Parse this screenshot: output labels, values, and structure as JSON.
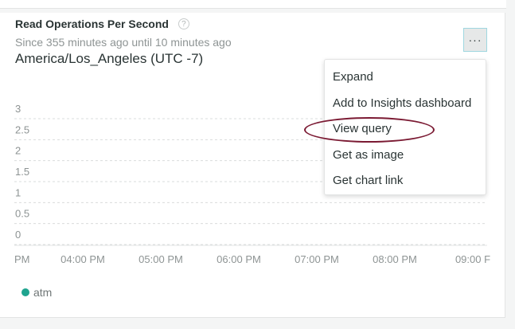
{
  "card": {
    "title": "Read Operations Per Second",
    "subtitle": "Since 355 minutes ago until 10 minutes ago",
    "timezone": "America/Los_Angeles (UTC -7)",
    "more_label": "···"
  },
  "menu": {
    "items": [
      {
        "label": "Expand"
      },
      {
        "label": "Add to Insights dashboard"
      },
      {
        "label": "View query"
      },
      {
        "label": "Get as image"
      },
      {
        "label": "Get chart link"
      }
    ]
  },
  "legend": {
    "series_label": "atm"
  },
  "colors": {
    "series": "#1fa48f",
    "highlight_oval": "#7b1a33",
    "grid": "#d9dcdc"
  },
  "chart_data": {
    "type": "line",
    "title": "Read Operations Per Second",
    "xlabel": "",
    "ylabel": "",
    "x_ticks": [
      "PM",
      "04:00 PM",
      "05:00 PM",
      "06:00 PM",
      "07:00 PM",
      "08:00 PM",
      "09:00 F"
    ],
    "y_ticks": [
      "3",
      "2.5",
      "2",
      "1.5",
      "1",
      "0.5",
      "0"
    ],
    "ylim": [
      0,
      3
    ],
    "grid": true,
    "series": [
      {
        "name": "atm",
        "values": []
      }
    ],
    "legend_position": "bottom-left"
  }
}
